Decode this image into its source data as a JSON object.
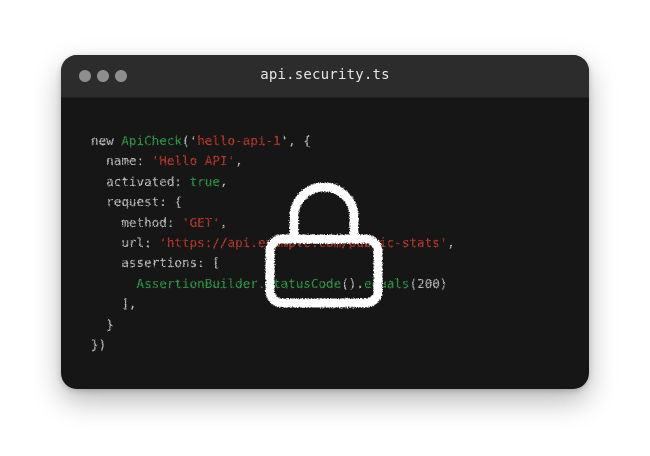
{
  "window": {
    "title": "api.security.ts",
    "traffic_light_color": "#8e8e8e",
    "background_color": "#161616",
    "titlebar_color": "#2c2c2c"
  },
  "code": {
    "colors": {
      "plain": "#bdbdbd",
      "function": "#2e9a46",
      "string": "#c0392b"
    },
    "lines": [
      [
        {
          "t": "new ",
          "c": "plain"
        },
        {
          "t": "ApiCheck",
          "c": "fn"
        },
        {
          "t": "('",
          "c": "plain"
        },
        {
          "t": "hello-api-1",
          "c": "str"
        },
        {
          "t": "', {",
          "c": "plain"
        }
      ],
      [
        {
          "t": "  name: ",
          "c": "plain"
        },
        {
          "t": "'Hello API'",
          "c": "str"
        },
        {
          "t": ",",
          "c": "plain"
        }
      ],
      [
        {
          "t": "  activated: ",
          "c": "plain"
        },
        {
          "t": "true",
          "c": "fn"
        },
        {
          "t": ",",
          "c": "plain"
        }
      ],
      [
        {
          "t": "  request: {",
          "c": "plain"
        }
      ],
      [
        {
          "t": "    method: ",
          "c": "plain"
        },
        {
          "t": "'GET'",
          "c": "str"
        },
        {
          "t": ",",
          "c": "plain"
        }
      ],
      [
        {
          "t": "    url: ",
          "c": "plain"
        },
        {
          "t": "'https://api.example.com/public-stats'",
          "c": "str"
        },
        {
          "t": ",",
          "c": "plain"
        }
      ],
      [
        {
          "t": "    assertions: [",
          "c": "plain"
        }
      ],
      [
        {
          "t": "      ",
          "c": "plain"
        },
        {
          "t": "AssertionBuilder.statusCode",
          "c": "fn"
        },
        {
          "t": "().",
          "c": "plain"
        },
        {
          "t": "equals",
          "c": "fn"
        },
        {
          "t": "(200)",
          "c": "plain"
        }
      ],
      [
        {
          "t": "    ],",
          "c": "plain"
        }
      ],
      [
        {
          "t": "  }",
          "c": "plain"
        }
      ],
      [
        {
          "t": "})",
          "c": "plain"
        }
      ]
    ]
  },
  "overlay": {
    "icon": "lock-icon",
    "color": "#ffffff"
  }
}
